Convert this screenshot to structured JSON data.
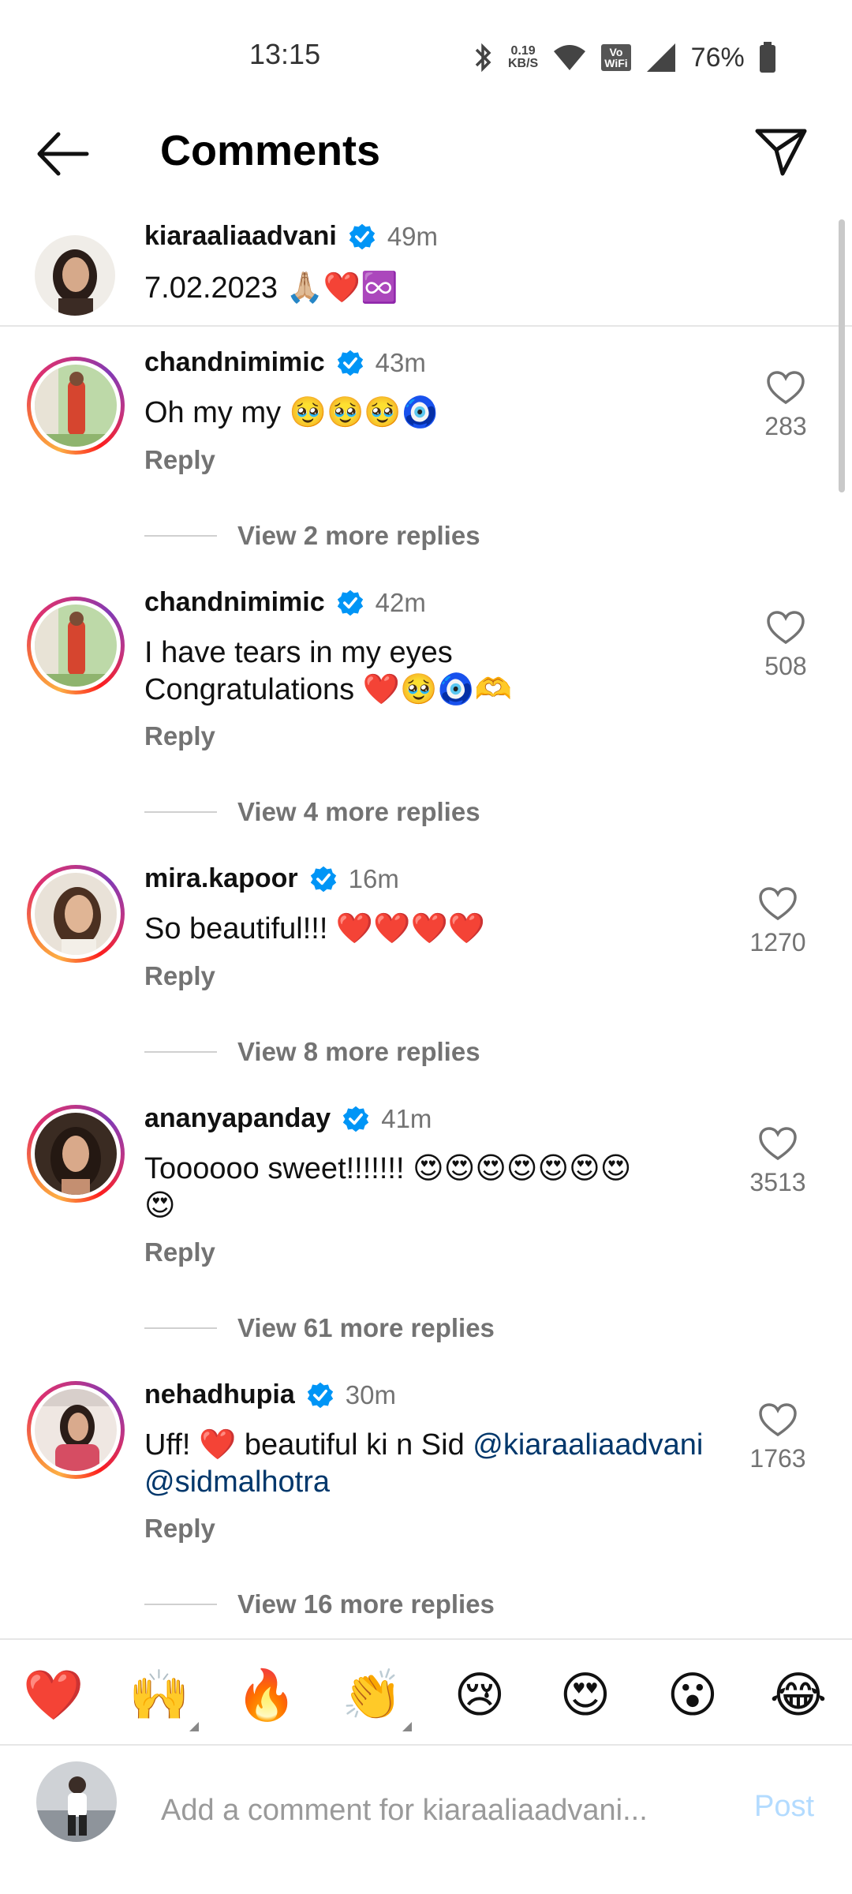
{
  "status_bar": {
    "time": "13:15",
    "net_speed_value": "0.19",
    "net_speed_unit": "KB/S",
    "volte_top": "Vo",
    "volte_bottom": "WiFi",
    "battery": "76%"
  },
  "header": {
    "title": "Comments"
  },
  "caption": {
    "username": "kiaraaliaadvani",
    "time": "49m",
    "text": "7.02.2023 🙏🏼❤️♾️"
  },
  "comments": [
    {
      "username": "chandnimimic",
      "time": "43m",
      "text": "Oh my my 🥹🥹🥹🧿",
      "reply_label": "Reply",
      "likes": "283",
      "view_replies": "View 2 more replies"
    },
    {
      "username": "chandnimimic",
      "time": "42m",
      "text_line1": "I have tears in my eyes",
      "text_line2": "Congratulations ❤️🥹🧿🫶",
      "reply_label": "Reply",
      "likes": "508",
      "view_replies": "View 4 more replies"
    },
    {
      "username": "mira.kapoor",
      "time": "16m",
      "text": "So beautiful!!! ❤️❤️❤️❤️",
      "reply_label": "Reply",
      "likes": "1270",
      "view_replies": "View 8 more replies"
    },
    {
      "username": "ananyapanday",
      "time": "41m",
      "text_line1": "Toooooo sweet!!!!!!! 😍😍😍😍😍😍😍",
      "text_line2": "😍",
      "reply_label": "Reply",
      "likes": "3513",
      "view_replies": "View 61 more replies"
    },
    {
      "username": "nehadhupia",
      "time": "30m",
      "text_prefix": "Uff! ❤️ beautiful ki n Sid ",
      "mention1": "@kiaraaliaadvani",
      "mention2": "@sidmalhotra",
      "reply_label": "Reply",
      "likes": "1763",
      "view_replies": "View 16 more replies"
    }
  ],
  "reactions": [
    "❤️",
    "🙌",
    "🔥",
    "👏",
    "😢",
    "😍",
    "😮",
    "😂"
  ],
  "composer": {
    "placeholder": "Add a comment for kiaraaliaadvani...",
    "post_label": "Post"
  },
  "colors": {
    "verified": "#0095f6",
    "muted_text": "#737373",
    "mention": "#00376b",
    "post_disabled": "#b3dbff"
  }
}
